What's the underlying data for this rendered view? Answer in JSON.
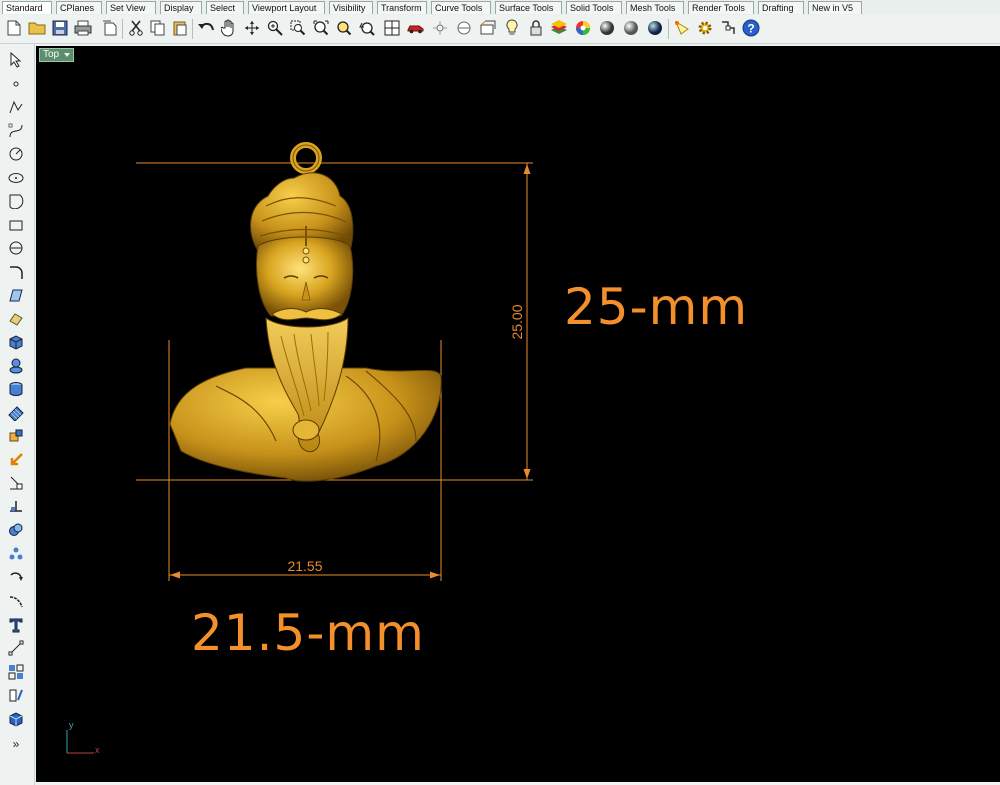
{
  "tabs": [
    "Standard",
    "CPlanes",
    "Set View",
    "Display",
    "Select",
    "Viewport Layout",
    "Visibility",
    "Transform",
    "Curve Tools",
    "Surface Tools",
    "Solid Tools",
    "Mesh Tools",
    "Render Tools",
    "Drafting",
    "New in V5"
  ],
  "active_tab": "Standard",
  "viewport": {
    "name": "Top",
    "dimension_vertical": "25.00",
    "dimension_horizontal": "21.55",
    "label_height": "25-mm",
    "label_width": "21.5-mm",
    "axis_y": "y",
    "axis_x": "x"
  },
  "colors": {
    "dimension": "#e88a2e",
    "label": "#f4902c",
    "gold": "#d9a520",
    "viewport_bg": "#000000"
  }
}
